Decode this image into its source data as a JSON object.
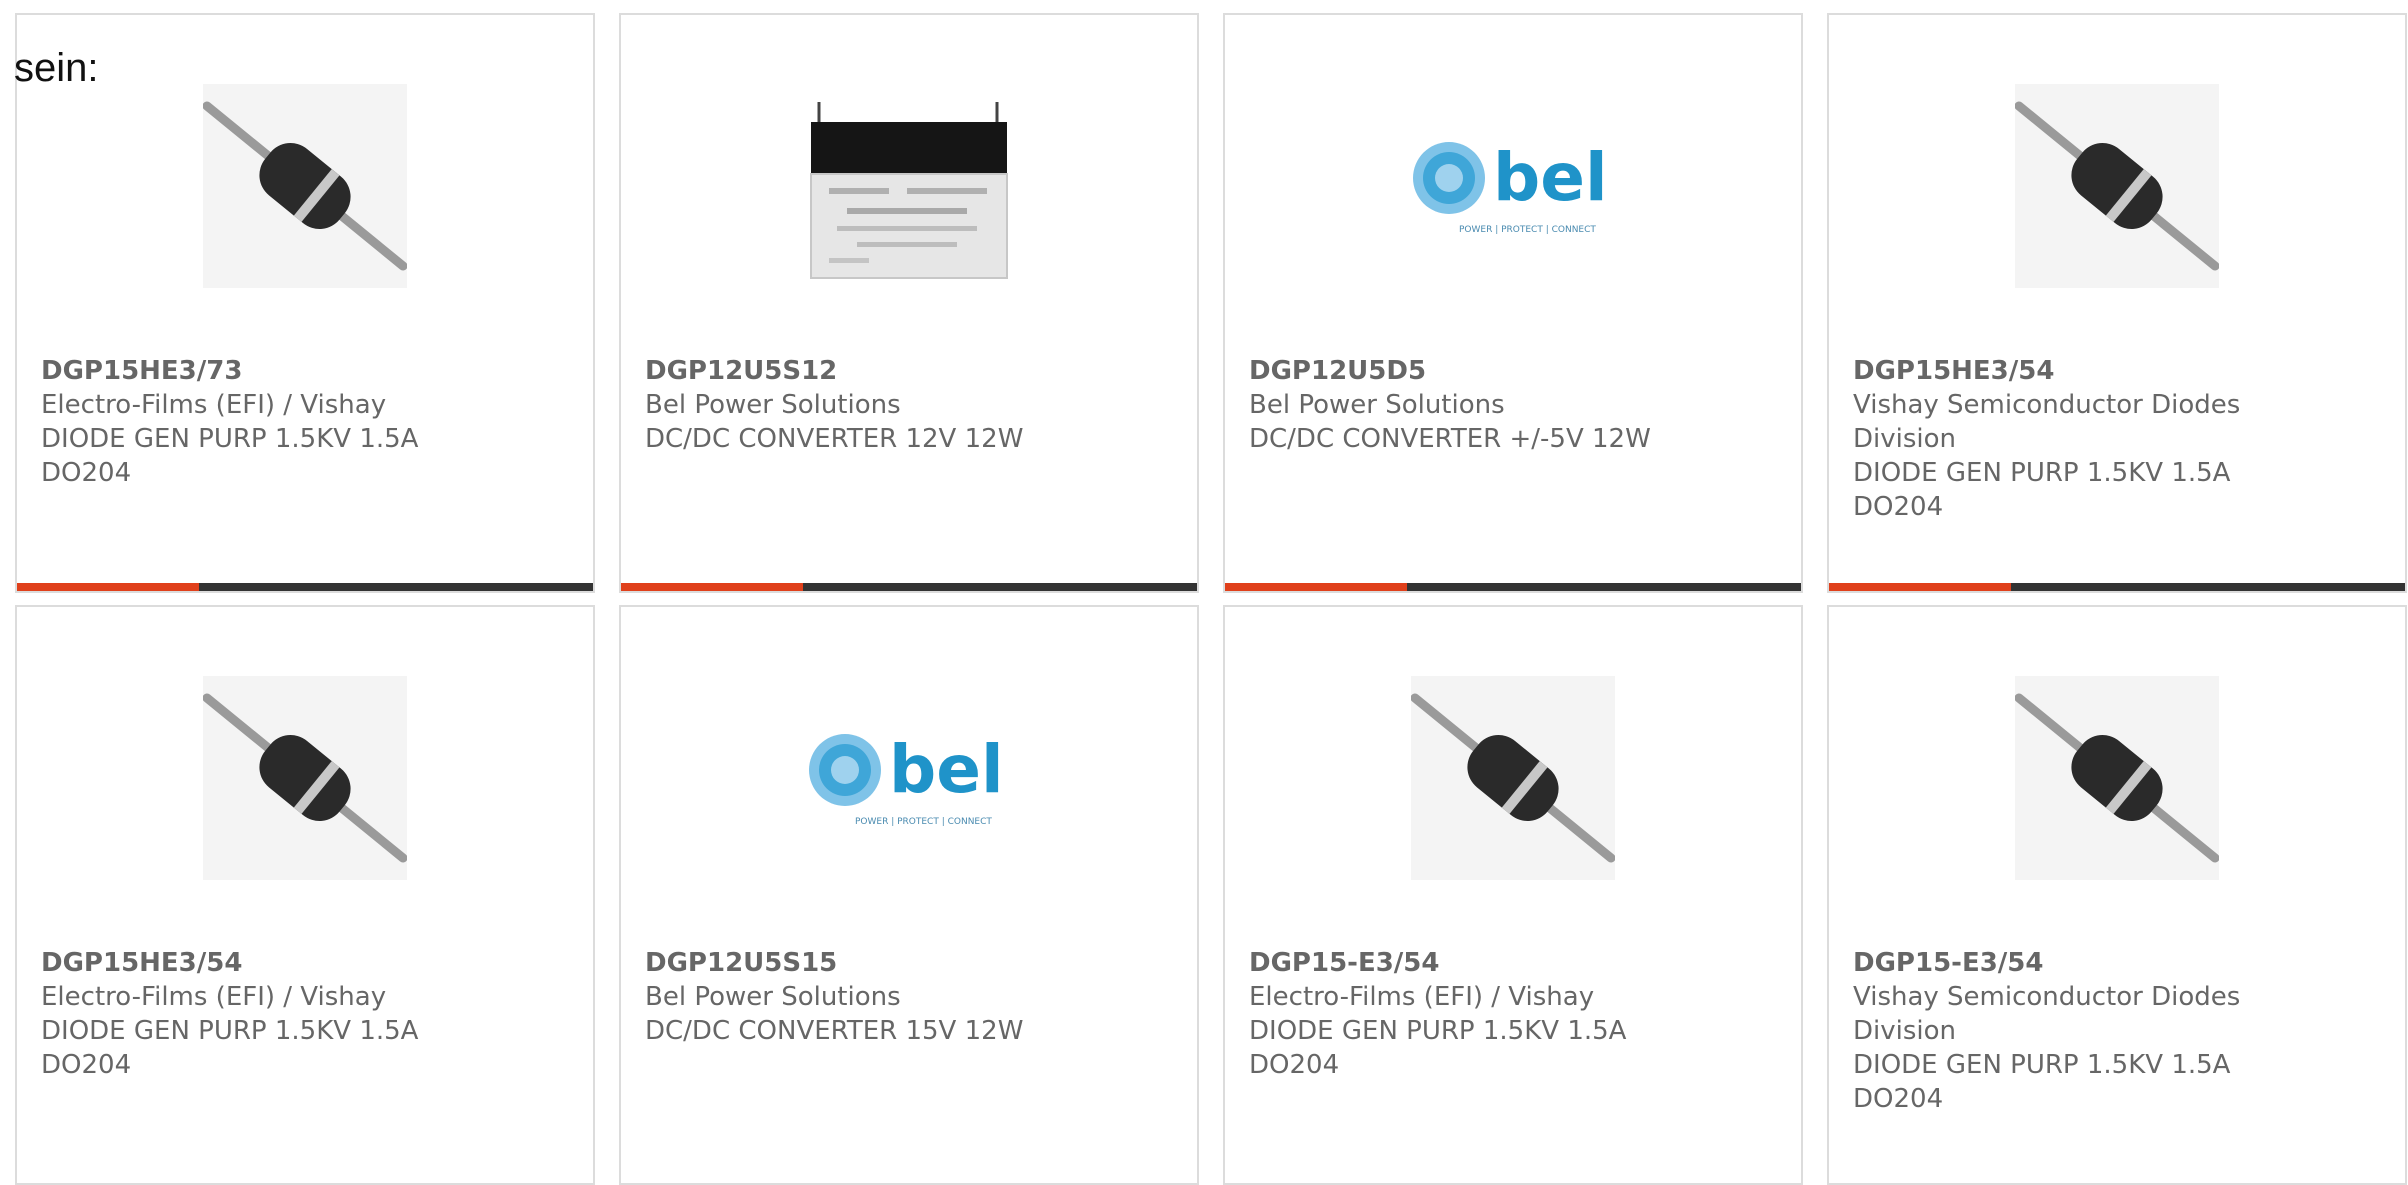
{
  "intro_text": "sein:",
  "colors": {
    "accent": "#e0401b",
    "bar_dark": "#333333",
    "text_gray": "#666666",
    "bel_blue": "#1f93c9"
  },
  "products": [
    {
      "part_number": "DGP15HE3/73",
      "manufacturer": "Electro-Films (EFI) / Vishay",
      "desc_line1": "DIODE GEN PURP 1.5KV 1.5A",
      "desc_line2": "DO204",
      "image": "axial-diode-icon"
    },
    {
      "part_number": "DGP12U5S12",
      "manufacturer": "Bel Power Solutions",
      "desc_line1": "DC/DC CONVERTER 12V 12W",
      "desc_line2": "",
      "image": "dc-dc-converter-module"
    },
    {
      "part_number": "DGP12U5D5",
      "manufacturer": "Bel Power Solutions",
      "desc_line1": "DC/DC CONVERTER +/-5V 12W",
      "desc_line2": "",
      "image": "bel-logo",
      "logo_text": "bel",
      "logo_tagline": "POWER | PROTECT | CONNECT"
    },
    {
      "part_number": "DGP15HE3/54",
      "manufacturer": "Vishay Semiconductor Diodes Division",
      "desc_line1": "DIODE GEN PURP 1.5KV 1.5A",
      "desc_line2": "DO204",
      "image": "axial-diode-icon"
    },
    {
      "part_number": "DGP15HE3/54",
      "manufacturer": "Electro-Films (EFI) / Vishay",
      "desc_line1": "DIODE GEN PURP 1.5KV 1.5A",
      "desc_line2": "DO204",
      "image": "axial-diode-icon"
    },
    {
      "part_number": "DGP12U5S15",
      "manufacturer": "Bel Power Solutions",
      "desc_line1": "DC/DC CONVERTER 15V 12W",
      "desc_line2": "",
      "image": "bel-logo",
      "logo_text": "bel",
      "logo_tagline": "POWER | PROTECT | CONNECT"
    },
    {
      "part_number": "DGP15-E3/54",
      "manufacturer": "Electro-Films (EFI) / Vishay",
      "desc_line1": "DIODE GEN PURP 1.5KV 1.5A",
      "desc_line2": "DO204",
      "image": "axial-diode-icon"
    },
    {
      "part_number": "DGP15-E3/54",
      "manufacturer": "Vishay Semiconductor Diodes Division",
      "desc_line1": "DIODE GEN PURP 1.5KV 1.5A",
      "desc_line2": "DO204",
      "image": "axial-diode-icon"
    }
  ]
}
